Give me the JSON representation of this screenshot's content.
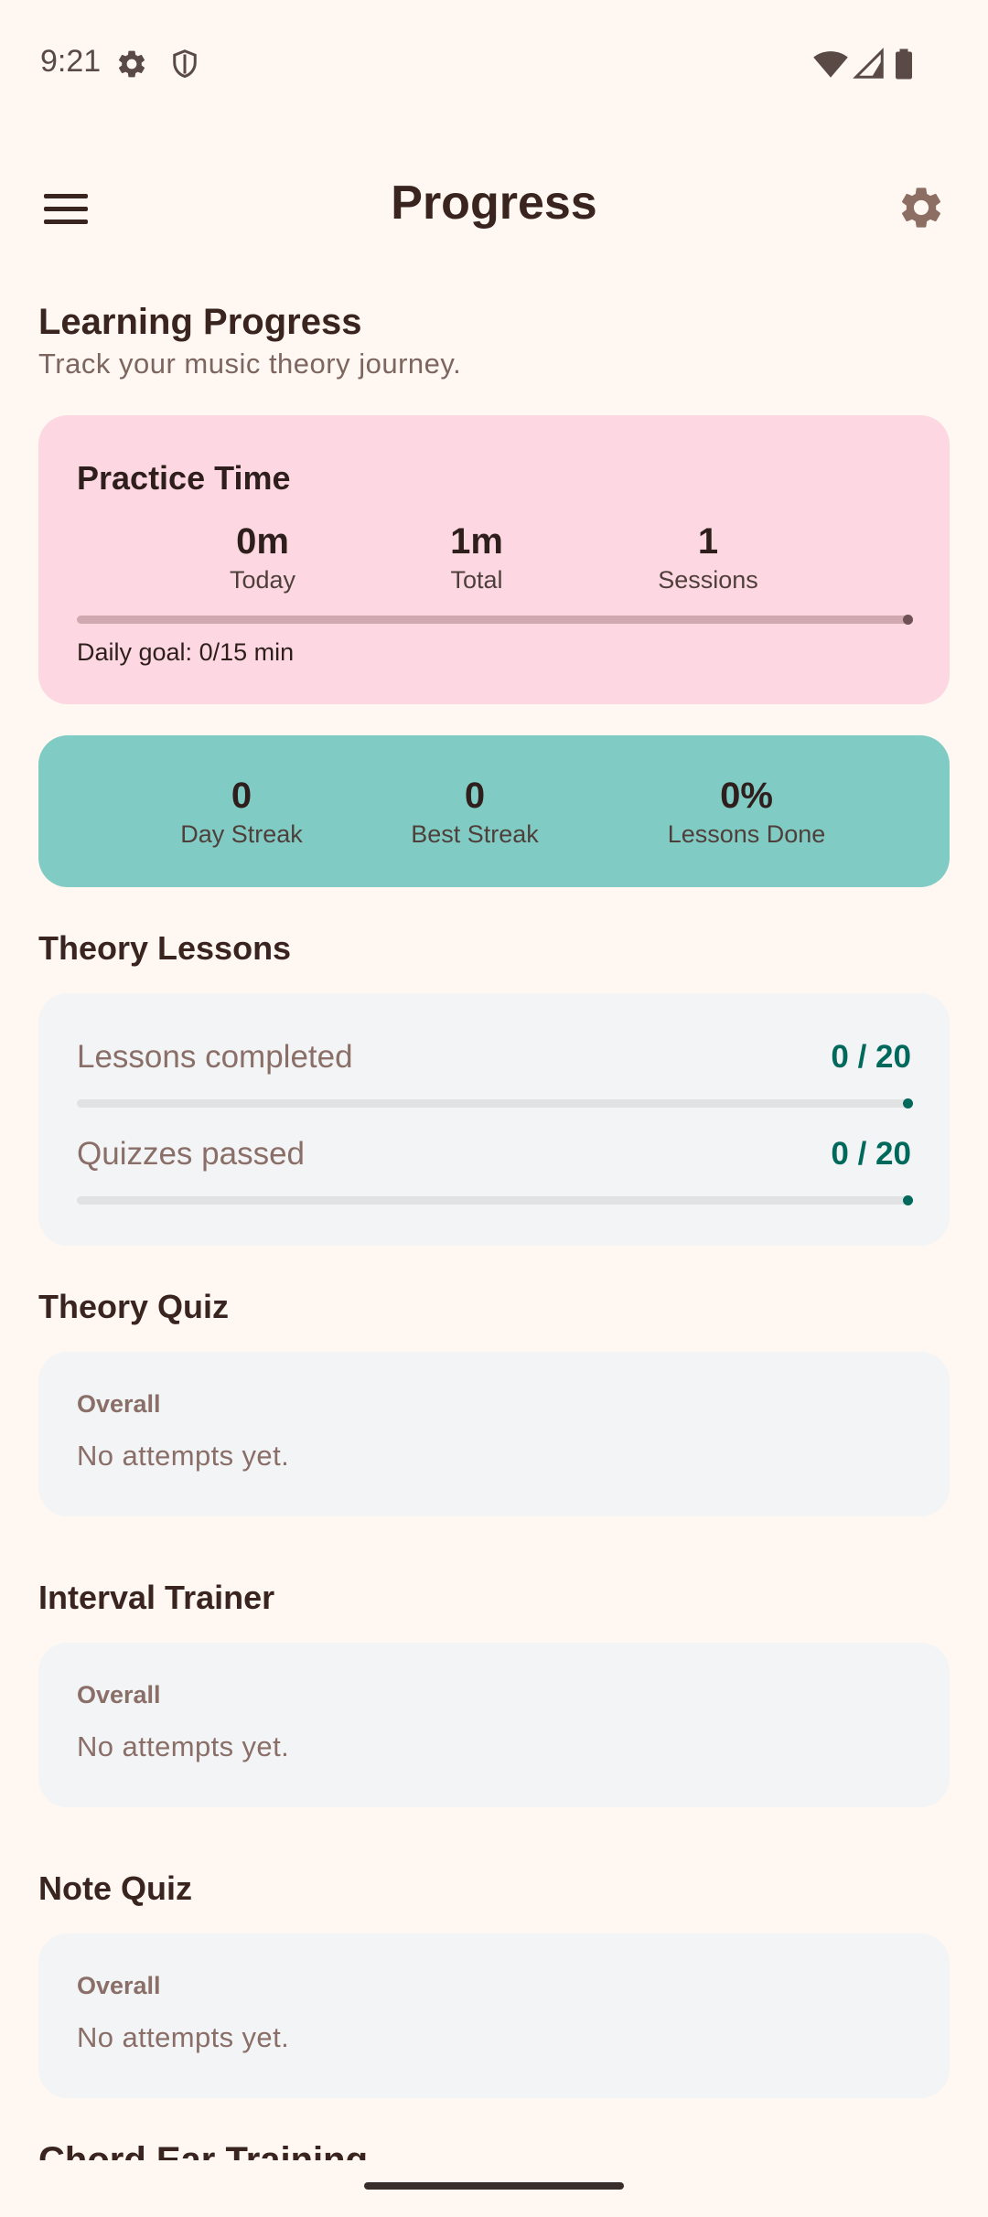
{
  "status_bar": {
    "time": "9:21",
    "icons": [
      "gear-icon",
      "shield-icon",
      "wifi-icon",
      "signal-icon",
      "battery-icon"
    ]
  },
  "app_bar": {
    "title": "Progress",
    "menu_icon": "menu-icon",
    "settings_icon": "gear-icon"
  },
  "header": {
    "title": "Learning Progress",
    "subtitle": "Track your music theory journey."
  },
  "practice": {
    "title": "Practice Time",
    "stats": [
      {
        "value": "0m",
        "label": "Today"
      },
      {
        "value": "1m",
        "label": "Total"
      },
      {
        "value": "1",
        "label": "Sessions"
      }
    ],
    "daily_goal": "Daily goal: 0/15 min",
    "goal_progress": 0
  },
  "streaks": [
    {
      "value": "0",
      "label": "Day Streak"
    },
    {
      "value": "0",
      "label": "Best Streak"
    },
    {
      "value": "0%",
      "label": "Lessons Done"
    }
  ],
  "theory_lessons": {
    "title": "Theory Lessons",
    "rows": [
      {
        "label": "Lessons completed",
        "value": "0 / 20",
        "progress": 0
      },
      {
        "label": "Quizzes passed",
        "value": "0 / 20",
        "progress": 0
      }
    ]
  },
  "sections": [
    {
      "title": "Theory Quiz",
      "overall_label": "Overall",
      "message": "No attempts yet."
    },
    {
      "title": "Interval Trainer",
      "overall_label": "Overall",
      "message": "No attempts yet."
    },
    {
      "title": "Note Quiz",
      "overall_label": "Overall",
      "message": "No attempts yet."
    }
  ],
  "next_section_title": "Chord Ear Training",
  "colors": {
    "background": "#fff8f2",
    "practice_card": "#fdd8e2",
    "streak_card": "#80cbc4",
    "accent": "#00695c",
    "settings_icon": "#8d6e63"
  }
}
